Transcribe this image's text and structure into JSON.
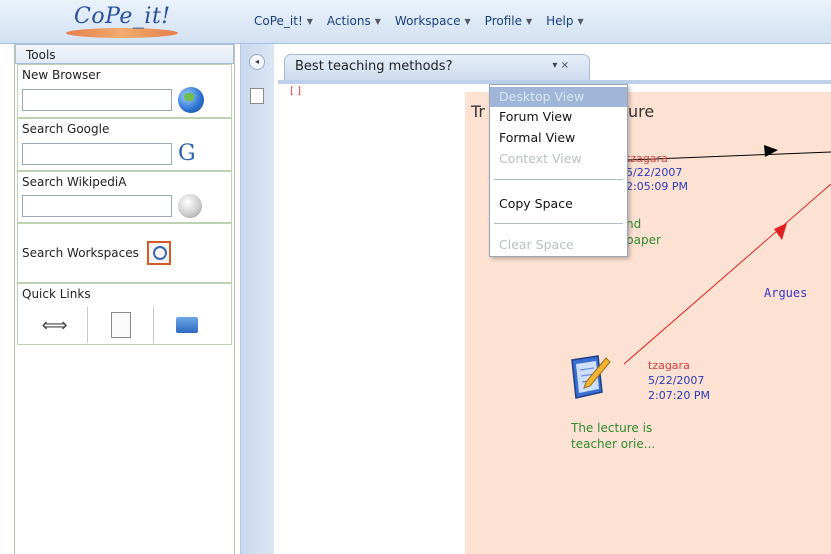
{
  "app": {
    "logo_text": "CoPe_it!"
  },
  "menubar": {
    "items": [
      {
        "label": "CoPe_it!"
      },
      {
        "label": "Actions"
      },
      {
        "label": "Workspace"
      },
      {
        "label": "Profile"
      },
      {
        "label": "Help"
      }
    ],
    "caret": "▼"
  },
  "tools": {
    "header": "Tools",
    "new_browser": {
      "label": "New Browser",
      "value": "",
      "icon": "globe-icon"
    },
    "search_google": {
      "label": "Search Google",
      "value": "",
      "icon_text": "G"
    },
    "search_wikipedia": {
      "label": "Search WikipediA",
      "value": "",
      "icon": "wikipedia-globe-icon"
    },
    "search_workspaces": {
      "label": "Search Workspaces",
      "icon": "search-workspace-icon"
    },
    "quick_links": {
      "label": "Quick Links",
      "icons": [
        "swap-arrows-icon",
        "document-icon",
        "folder-icon"
      ],
      "arrows_glyph": "⟺"
    }
  },
  "strip": {
    "collapse_glyph": "◂"
  },
  "tab": {
    "title": "Best teaching methods?",
    "controls": "▾ ×"
  },
  "canvas": {
    "corner_mark": "[ ]",
    "space_title_left": "Tr",
    "space_title_right": "ure",
    "nodes": [
      {
        "author": "tzagara",
        "date": "5/22/2007",
        "time": "2:05:09 PM",
        "text_line1": "nd",
        "text_line2": "paper"
      },
      {
        "author": "tzagara",
        "date": "5/22/2007",
        "time": "2:07:20 PM",
        "text_line1": "The lecture is",
        "text_line2": "teacher orie..."
      }
    ],
    "edge_label": "Argues",
    "colors": {
      "space_bg": "#fde2d3",
      "author": "#d43d3d",
      "meta": "#2a3bb8",
      "text": "#2f8a2f",
      "arrow_red": "#e02020",
      "arrow_black": "#000000"
    }
  },
  "context_menu": {
    "items": [
      {
        "label": "Desktop View",
        "state": "highlighted-disabled"
      },
      {
        "label": "Forum View",
        "state": "enabled"
      },
      {
        "label": "Formal View",
        "state": "enabled"
      },
      {
        "label": "Context View",
        "state": "disabled"
      },
      {
        "label": "Copy Space",
        "state": "enabled"
      },
      {
        "label": "Clear Space",
        "state": "disabled"
      }
    ]
  }
}
